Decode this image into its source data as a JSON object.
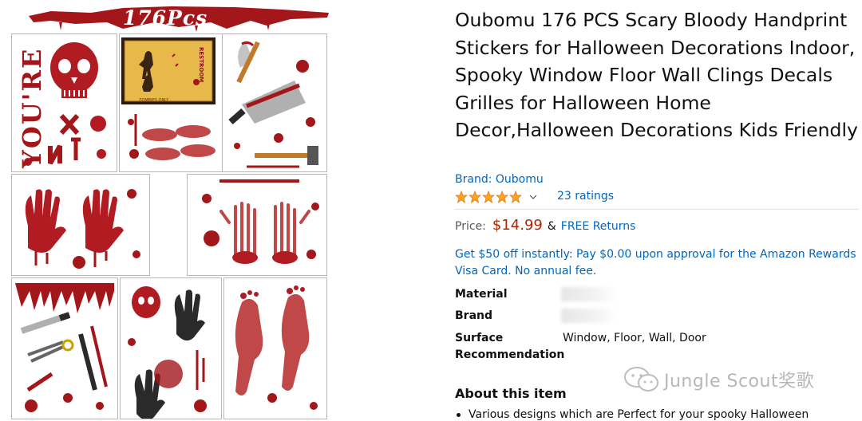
{
  "image": {
    "banner_text": "176Pcs",
    "sign_text": "RESTROOM",
    "sign_caption": "ZOMBIES ONLY",
    "youre_text": "YOU'RE",
    "next_letters": [
      "N",
      "E",
      "X",
      "T"
    ]
  },
  "product": {
    "title": "Oubomu 176 PCS Scary Bloody Handprint Stickers for Halloween Decorations Indoor, Spooky Window Floor Wall Clings Decals Grilles for Halloween Home Decor,Halloween Decorations Kids Friendly",
    "brand_link": "Brand: Oubomu",
    "rating_stars": 5,
    "ratings_count": "23 ratings",
    "price_label": "Price:",
    "price": "$14.99",
    "amp": "&",
    "free_returns": "FREE Returns",
    "offer": "Get $50 off instantly: Pay $0.00 upon approval for the Amazon Rewards Visa Card. No annual fee.",
    "attributes": [
      {
        "label": "Material",
        "value": ""
      },
      {
        "label": "Brand",
        "value": ""
      },
      {
        "label": "Surface Recommendation",
        "value": "Window, Floor, Wall, Door"
      }
    ],
    "about_heading": "About this item",
    "bullets": [
      "Various designs which are Perfect for your spooky Halloween"
    ]
  },
  "watermark": {
    "text": "Jungle Scout奖歌"
  },
  "colors": {
    "link": "#0066c0",
    "price": "#b12704",
    "star": "#ffa41c",
    "blood": "#a3161a",
    "text": "#0f1111"
  }
}
